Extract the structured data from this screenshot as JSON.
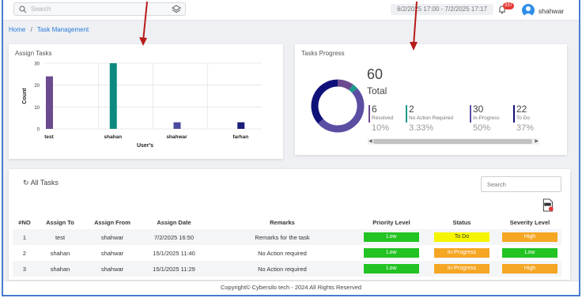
{
  "search": {
    "placeholder": "Search"
  },
  "header": {
    "date_range": "6/2/2025 17:00 - 7/2/2025 17:17",
    "notification_count": "337",
    "username": "shahwar"
  },
  "breadcrumb": {
    "home": "Home",
    "separator": "/",
    "current": "Task Management"
  },
  "assign_tasks": {
    "title": "Assign Tasks",
    "chart_data": {
      "type": "bar",
      "categories": [
        "test",
        "shahan",
        "shahwar",
        "farhan"
      ],
      "values": [
        24,
        30,
        3,
        3
      ],
      "xlabel": "User's",
      "ylabel": "Count",
      "ylim": [
        0,
        30
      ],
      "yticks": [
        0,
        10,
        20,
        30
      ],
      "colors": [
        "#6b4a8f",
        "#0c8a7f",
        "#4b4aa0",
        "#1a1f7a"
      ]
    }
  },
  "tasks_progress": {
    "title": "Tasks Progress",
    "total_value": "60",
    "total_label": "Total",
    "chart_data": {
      "type": "pie",
      "labels": [
        "Resolved",
        "No Action Required",
        "In-Progress",
        "To Do"
      ],
      "values": [
        6,
        2,
        30,
        22
      ],
      "colors": [
        "#6b4a8f",
        "#1a9a8a",
        "#5a4ea3",
        "#10127a"
      ]
    },
    "stats": [
      {
        "num": "6",
        "label": "Resolved",
        "pct": "10%",
        "color": "#6b4a8f"
      },
      {
        "num": "2",
        "label": "No Action Required",
        "pct": "3.33%",
        "color": "#1a9a8a"
      },
      {
        "num": "30",
        "label": "In-Progress",
        "pct": "50%",
        "color": "#5a4ea3"
      },
      {
        "num": "22",
        "label": "To Do",
        "pct": "37%",
        "color": "#10127a"
      }
    ]
  },
  "all_tasks": {
    "title": "All Tasks",
    "search_placeholder": "Search",
    "columns": [
      "#NO",
      "Assign To",
      "Assign From",
      "Assign Date",
      "Remarks",
      "Priority Level",
      "Status",
      "Severity Level"
    ],
    "rows": [
      {
        "no": "1",
        "to": "test",
        "from": "shahwar",
        "date": "7/2/2025 16:50",
        "remarks": "Remarks for the task",
        "priority": "Low",
        "status": "To Do",
        "severity": "High"
      },
      {
        "no": "2",
        "to": "shahan",
        "from": "shahwar",
        "date": "15/1/2025 11:40",
        "remarks": "No Action required",
        "priority": "Low",
        "status": "In-Progress",
        "severity": "Low"
      },
      {
        "no": "3",
        "to": "shahan",
        "from": "shahwar",
        "date": "15/1/2025 11:29",
        "remarks": "No Action required",
        "priority": "Low",
        "status": "In-Progress",
        "severity": "High"
      }
    ],
    "pill_colors": {
      "Low": "#22c322",
      "High": "#f5a623",
      "To Do": "#f5f500",
      "In-Progress": "#f5a623"
    }
  },
  "footer": {
    "text": "Copyright© Cybersilo tech - 2024 All Rights Reserved"
  }
}
